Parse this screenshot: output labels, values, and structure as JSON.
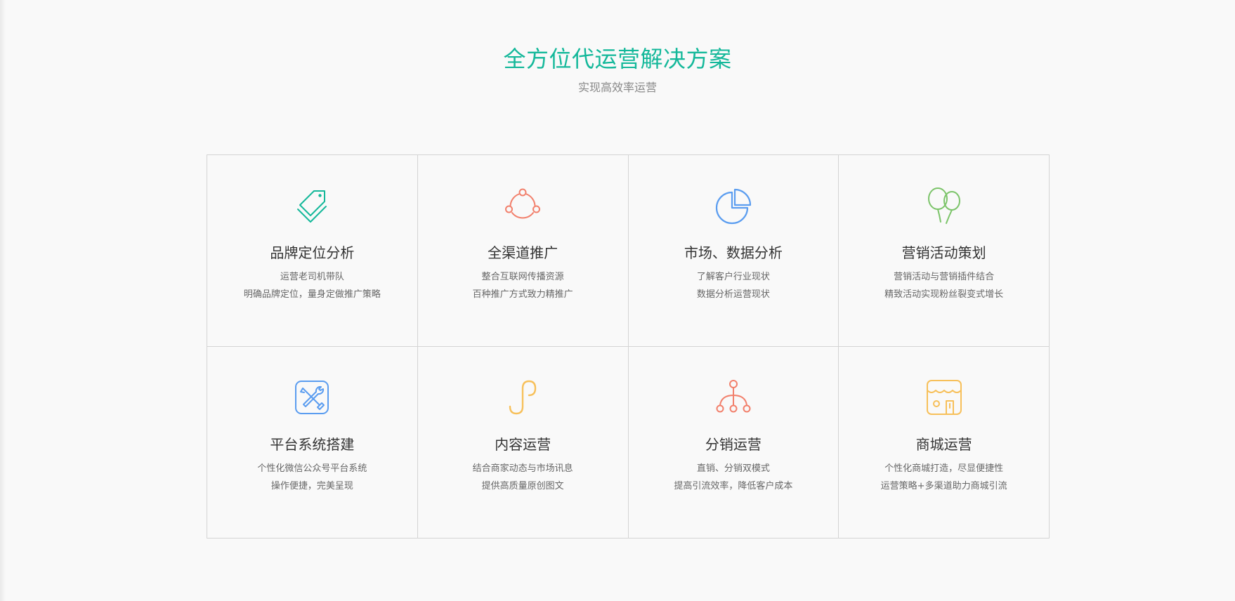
{
  "hero": {
    "title": "全方位代运营解决方案",
    "subtitle": "实现高效率运营"
  },
  "colors": {
    "accent": "#14b89a",
    "coral": "#f2806c",
    "blue": "#5b9df0",
    "green": "#7cc46a",
    "yellow": "#f7c05a"
  },
  "services": [
    {
      "icon": "price-tag-icon",
      "title": "品牌定位分析",
      "line1": "运营老司机带队",
      "line2": "明确品牌定位，量身定做推广策略"
    },
    {
      "icon": "share-nodes-icon",
      "title": "全渠道推广",
      "line1": "整合互联网传播资源",
      "line2": "百种推广方式致力精推广"
    },
    {
      "icon": "pie-chart-icon",
      "title": "市场、数据分析",
      "line1": "了解客户行业现状",
      "line2": "数据分析运营现状"
    },
    {
      "icon": "balloons-icon",
      "title": "营销活动策划",
      "line1": "营销活动与营销插件结合",
      "line2": "精致活动实现粉丝裂变式增长"
    },
    {
      "icon": "tools-icon",
      "title": "平台系统搭建",
      "line1": "个性化微信公众号平台系统",
      "line2": "操作便捷，完美呈现"
    },
    {
      "icon": "link-curve-icon",
      "title": "内容运营",
      "line1": "结合商家动态与市场讯息",
      "line2": "提供高质量原创图文"
    },
    {
      "icon": "hierarchy-icon",
      "title": "分销运营",
      "line1": "直销、分销双模式",
      "line2": "提高引流效率，降低客户成本"
    },
    {
      "icon": "storefront-icon",
      "title": "商城运营",
      "line1": "个性化商城打造，尽显便捷性",
      "line2": "运营策略+多渠道助力商城引流"
    }
  ]
}
